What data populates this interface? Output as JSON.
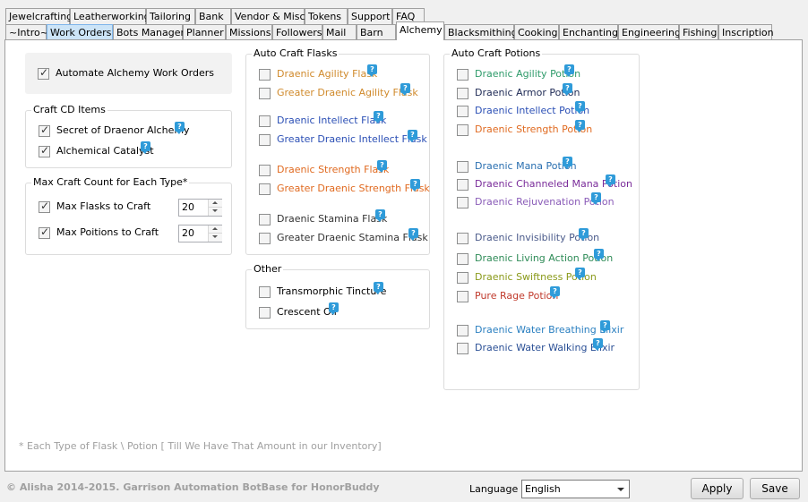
{
  "tabs_row1": [
    "Jewelcrafting",
    "Leatherworking",
    "Tailoring",
    "Bank",
    "Vendor & Misc",
    "Tokens",
    "Support",
    "FAQ"
  ],
  "tabs_row2": [
    "~Intro~",
    "Work Orders",
    "Bots Manager",
    "Planner",
    "Missions",
    "Followers",
    "Mail",
    "Barn",
    "Alchemy",
    "Blacksmithing",
    "Cooking",
    "Enchanting",
    "Engineering",
    "Fishing",
    "Inscription"
  ],
  "automate": {
    "label": "Automate Alchemy Work Orders",
    "checked": true
  },
  "craft_cd": {
    "title": "Craft CD Items",
    "items": [
      {
        "label": "Secret of Draenor Alchemy",
        "checked": true
      },
      {
        "label": "Alchemical Catalyst",
        "checked": true
      }
    ]
  },
  "max_craft": {
    "title": "Max Craft Count for Each Type*",
    "flasks": {
      "label": "Max Flasks to Craft",
      "checked": true,
      "value": "20"
    },
    "potions": {
      "label": "Max Poitions to Craft",
      "checked": true,
      "value": "20"
    }
  },
  "auto_flasks": {
    "title": "Auto Craft Flasks",
    "items": [
      {
        "label": "Draenic Agility Flask",
        "color": "#d08a2c"
      },
      {
        "label": "Greater Draenic Agility Flask",
        "color": "#d08a2c"
      },
      {
        "label": "Draenic Intellect Flask",
        "color": "#2b4fb5"
      },
      {
        "label": "Greater Draenic Intellect Flask",
        "color": "#2b4fb5"
      },
      {
        "label": "Draenic Strength Flask",
        "color": "#e06a20"
      },
      {
        "label": "Greater Draenic Strength Flask",
        "color": "#e06a20"
      },
      {
        "label": "Draenic Stamina Flask",
        "color": "#333333"
      },
      {
        "label": "Greater Draenic Stamina Flask",
        "color": "#333333"
      }
    ]
  },
  "other": {
    "title": "Other",
    "items": [
      {
        "label": "Transmorphic Tincture",
        "color": "#000000"
      },
      {
        "label": "Crescent Oil",
        "color": "#000000"
      }
    ]
  },
  "auto_potions": {
    "title": "Auto Craft Potions",
    "items": [
      {
        "label": "Draenic Agility Potion",
        "color": "#2e9b6a"
      },
      {
        "label": "Draenic Armor Potion",
        "color": "#1e2a55"
      },
      {
        "label": "Draenic Intellect Potion",
        "color": "#2b4fb5"
      },
      {
        "label": "Draenic Strength Potion",
        "color": "#e06a20"
      },
      {
        "label": "Draenic Mana Potion",
        "color": "#2a6fb0"
      },
      {
        "label": "Draenic Channeled Mana Potion",
        "color": "#7a2c9a"
      },
      {
        "label": "Draenic Rejuvenation Potion",
        "color": "#8a5cb8"
      },
      {
        "label": "Draenic Invisibility Potion",
        "color": "#4a5a8a"
      },
      {
        "label": "Draenic Living Action Potion",
        "color": "#2e8b57"
      },
      {
        "label": "Draenic Swiftness Potion",
        "color": "#8a9a1a"
      },
      {
        "label": "Pure Rage Potion",
        "color": "#c0392b"
      },
      {
        "label": "Draenic Water Breathing Elixir",
        "color": "#2a7fc0"
      },
      {
        "label": "Draenic Water Walking Elixir",
        "color": "#2a4f95"
      }
    ]
  },
  "footnote": "* Each Type of Flask \\ Potion [ Till We Have That Amount in our Inventory]",
  "copyright": "© Alisha 2014-2015. Garrison Automation BotBase for HonorBuddy",
  "language": {
    "label": "Language",
    "value": "English"
  },
  "buttons": {
    "apply": "Apply",
    "save": "Save"
  },
  "help_glyph": "?"
}
